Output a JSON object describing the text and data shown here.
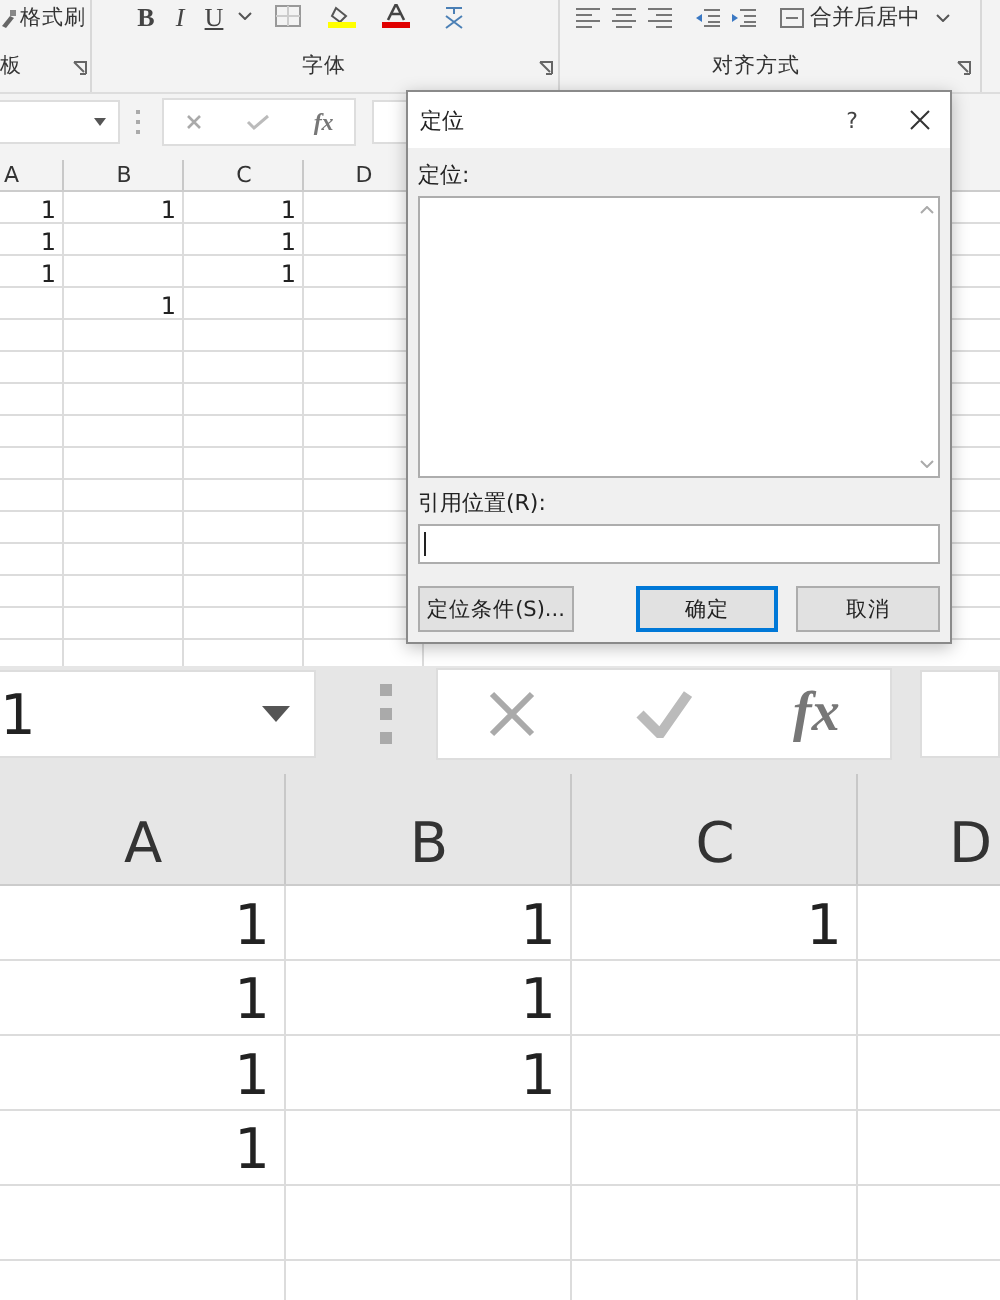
{
  "ribbon": {
    "clipboard": {
      "format_painter": "格式刷",
      "group_label": "板"
    },
    "font": {
      "format_buttons": [
        "B",
        "I",
        "U"
      ],
      "group_label": "字体"
    },
    "alignment": {
      "merge_button": "合并后居中",
      "group_label": "对齐方式"
    }
  },
  "sheet_view": {
    "fx": "fx",
    "columns": [
      "A",
      "B",
      "C",
      "D"
    ],
    "rows": [
      [
        "1",
        "1",
        "1",
        null
      ],
      [
        "1",
        null,
        "1",
        null
      ],
      [
        "1",
        null,
        "1",
        null
      ],
      [
        null,
        "1",
        null,
        null
      ]
    ]
  },
  "dialog": {
    "title": "定位",
    "help": "?",
    "list_label": "定位:",
    "reference_label": "引用位置(R):",
    "buttons": [
      {
        "label": "定位条件(S)...",
        "default": false
      },
      {
        "label": "确定",
        "default": true
      },
      {
        "label": "取消",
        "default": false
      }
    ]
  },
  "zoomed_view": {
    "name_box": "1",
    "fx": "fx",
    "columns": [
      "A",
      "B",
      "C",
      "D"
    ],
    "rows": [
      [
        "1",
        "1",
        "1",
        null
      ],
      [
        "1",
        "1",
        null,
        null
      ],
      [
        "1",
        "1",
        null,
        null
      ],
      [
        "1",
        null,
        null,
        null
      ]
    ]
  }
}
